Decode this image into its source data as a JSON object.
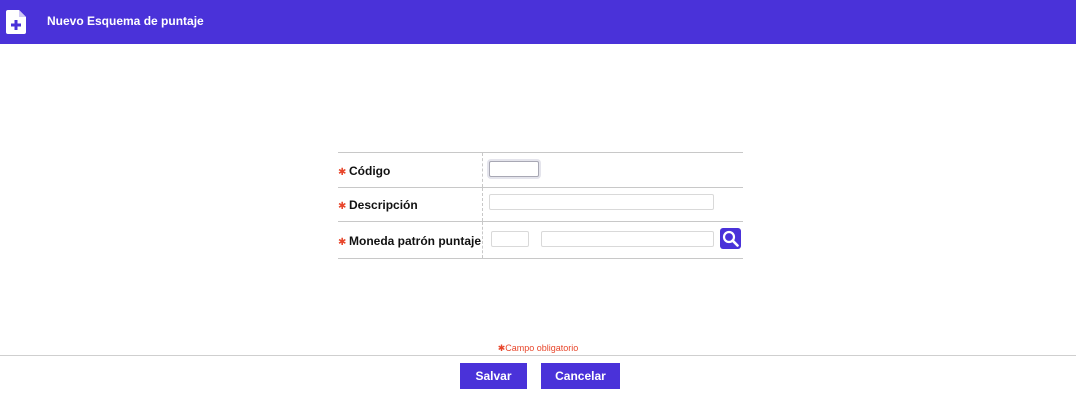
{
  "header": {
    "action_label": "Nuevo",
    "title": "Esquema de puntaje",
    "icon": "new-document-icon",
    "background": "#4a32d9"
  },
  "form": {
    "required_marker": "✱",
    "fields": [
      {
        "label": "Código",
        "value": ""
      },
      {
        "label": "Descripción",
        "value": ""
      },
      {
        "label": "Moneda patrón puntaje",
        "code_value": "",
        "name_value": "",
        "lookup_icon": "search-icon"
      }
    ]
  },
  "footer": {
    "required_note": "✱Campo obligatorio",
    "save_label": "Salvar",
    "cancel_label": "Cancelar"
  }
}
